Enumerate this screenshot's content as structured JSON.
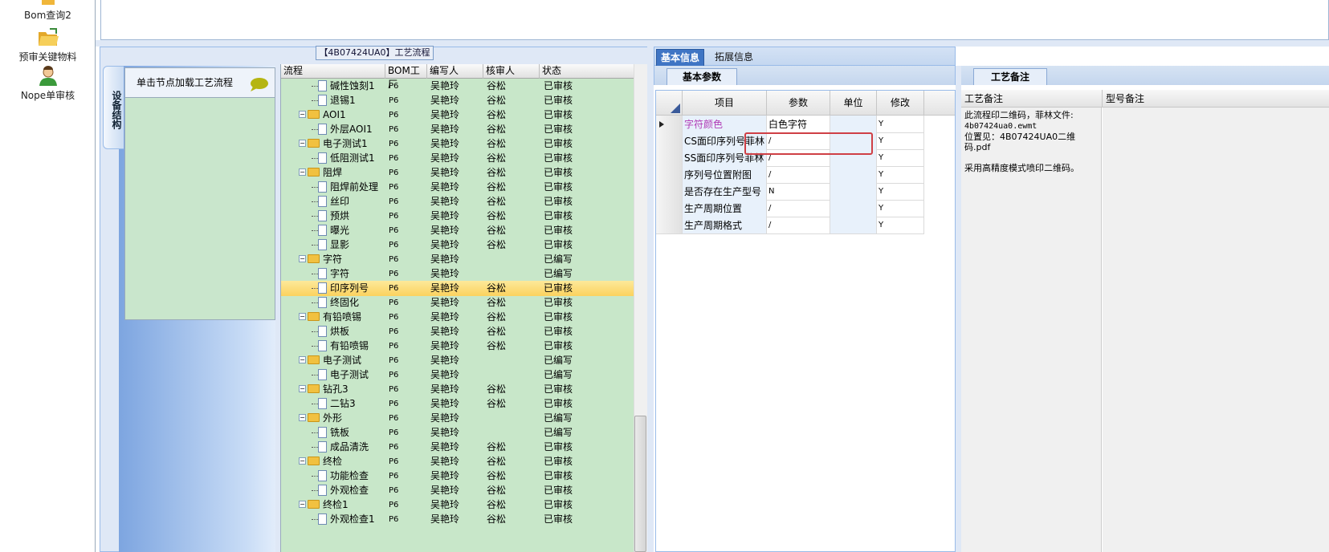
{
  "sidebar": {
    "items": [
      {
        "label": "Bom查询2",
        "icon": "bom-query-icon"
      },
      {
        "label": "预审关键物料",
        "icon": "folder-open-icon"
      },
      {
        "label": "Nope单审核",
        "icon": "user-icon"
      }
    ]
  },
  "process_panel": {
    "title": "【4B07424UA0】工艺流程",
    "vertical_tab": "设备结构",
    "node_header": "单击节点加载工艺流程"
  },
  "tree": {
    "columns": [
      "流程",
      "BOM工厂",
      "编写人",
      "核审人",
      "状态"
    ],
    "rows": [
      {
        "name": "碱性蚀刻1",
        "level": 2,
        "kind": "doc",
        "plant": "P6",
        "writer": "吴艳玲",
        "reviewer": "谷松",
        "status": "已审核"
      },
      {
        "name": "退锡1",
        "level": 2,
        "kind": "doc",
        "plant": "P6",
        "writer": "吴艳玲",
        "reviewer": "谷松",
        "status": "已审核"
      },
      {
        "name": "AOI1",
        "level": 1,
        "kind": "folder",
        "plant": "P6",
        "writer": "吴艳玲",
        "reviewer": "谷松",
        "status": "已审核"
      },
      {
        "name": "外层AOI1",
        "level": 2,
        "kind": "doc",
        "plant": "P6",
        "writer": "吴艳玲",
        "reviewer": "谷松",
        "status": "已审核"
      },
      {
        "name": "电子测试1",
        "level": 1,
        "kind": "folder",
        "plant": "P6",
        "writer": "吴艳玲",
        "reviewer": "谷松",
        "status": "已审核"
      },
      {
        "name": "低阻测试1",
        "level": 2,
        "kind": "doc",
        "plant": "P6",
        "writer": "吴艳玲",
        "reviewer": "谷松",
        "status": "已审核"
      },
      {
        "name": "阻焊",
        "level": 1,
        "kind": "folder",
        "plant": "P6",
        "writer": "吴艳玲",
        "reviewer": "谷松",
        "status": "已审核"
      },
      {
        "name": "阻焊前处理",
        "level": 2,
        "kind": "doc",
        "plant": "P6",
        "writer": "吴艳玲",
        "reviewer": "谷松",
        "status": "已审核"
      },
      {
        "name": "丝印",
        "level": 2,
        "kind": "doc",
        "plant": "P6",
        "writer": "吴艳玲",
        "reviewer": "谷松",
        "status": "已审核"
      },
      {
        "name": "预烘",
        "level": 2,
        "kind": "doc",
        "plant": "P6",
        "writer": "吴艳玲",
        "reviewer": "谷松",
        "status": "已审核"
      },
      {
        "name": "曝光",
        "level": 2,
        "kind": "doc",
        "plant": "P6",
        "writer": "吴艳玲",
        "reviewer": "谷松",
        "status": "已审核"
      },
      {
        "name": "显影",
        "level": 2,
        "kind": "doc",
        "plant": "P6",
        "writer": "吴艳玲",
        "reviewer": "谷松",
        "status": "已审核"
      },
      {
        "name": "字符",
        "level": 1,
        "kind": "folder",
        "plant": "P6",
        "writer": "吴艳玲",
        "reviewer": "",
        "status": "已编写"
      },
      {
        "name": "字符",
        "level": 2,
        "kind": "doc",
        "plant": "P6",
        "writer": "吴艳玲",
        "reviewer": "",
        "status": "已编写"
      },
      {
        "name": "印序列号",
        "level": 2,
        "kind": "doc",
        "plant": "P6",
        "writer": "吴艳玲",
        "reviewer": "谷松",
        "status": "已审核",
        "selected": true
      },
      {
        "name": "终固化",
        "level": 2,
        "kind": "doc",
        "plant": "P6",
        "writer": "吴艳玲",
        "reviewer": "谷松",
        "status": "已审核"
      },
      {
        "name": "有铅喷锡",
        "level": 1,
        "kind": "folder",
        "plant": "P6",
        "writer": "吴艳玲",
        "reviewer": "谷松",
        "status": "已审核"
      },
      {
        "name": "烘板",
        "level": 2,
        "kind": "doc",
        "plant": "P6",
        "writer": "吴艳玲",
        "reviewer": "谷松",
        "status": "已审核"
      },
      {
        "name": "有铅喷锡",
        "level": 2,
        "kind": "doc",
        "plant": "P6",
        "writer": "吴艳玲",
        "reviewer": "谷松",
        "status": "已审核"
      },
      {
        "name": "电子测试",
        "level": 1,
        "kind": "folder",
        "plant": "P6",
        "writer": "吴艳玲",
        "reviewer": "",
        "status": "已编写"
      },
      {
        "name": "电子测试",
        "level": 2,
        "kind": "doc",
        "plant": "P6",
        "writer": "吴艳玲",
        "reviewer": "",
        "status": "已编写"
      },
      {
        "name": "钻孔3",
        "level": 1,
        "kind": "folder",
        "plant": "P6",
        "writer": "吴艳玲",
        "reviewer": "谷松",
        "status": "已审核"
      },
      {
        "name": "二钻3",
        "level": 2,
        "kind": "doc",
        "plant": "P6",
        "writer": "吴艳玲",
        "reviewer": "谷松",
        "status": "已审核"
      },
      {
        "name": "外形",
        "level": 1,
        "kind": "folder",
        "plant": "P6",
        "writer": "吴艳玲",
        "reviewer": "",
        "status": "已编写"
      },
      {
        "name": "铣板",
        "level": 2,
        "kind": "doc",
        "plant": "P6",
        "writer": "吴艳玲",
        "reviewer": "",
        "status": "已编写"
      },
      {
        "name": "成品清洗",
        "level": 2,
        "kind": "doc",
        "plant": "P6",
        "writer": "吴艳玲",
        "reviewer": "谷松",
        "status": "已审核"
      },
      {
        "name": "终检",
        "level": 1,
        "kind": "folder",
        "plant": "P6",
        "writer": "吴艳玲",
        "reviewer": "谷松",
        "status": "已审核"
      },
      {
        "name": "功能检查",
        "level": 2,
        "kind": "doc",
        "plant": "P6",
        "writer": "吴艳玲",
        "reviewer": "谷松",
        "status": "已审核"
      },
      {
        "name": "外观检查",
        "level": 2,
        "kind": "doc",
        "plant": "P6",
        "writer": "吴艳玲",
        "reviewer": "谷松",
        "status": "已审核"
      },
      {
        "name": "终检1",
        "level": 1,
        "kind": "folder",
        "plant": "P6",
        "writer": "吴艳玲",
        "reviewer": "谷松",
        "status": "已审核"
      },
      {
        "name": "外观检查1",
        "level": 2,
        "kind": "doc",
        "plant": "P6",
        "writer": "吴艳玲",
        "reviewer": "谷松",
        "status": "已审核"
      }
    ]
  },
  "info_tabs": {
    "basic": "基本信息",
    "extended": "拓展信息"
  },
  "param_tab": "基本参数",
  "param_grid": {
    "columns": [
      "项目",
      "参数",
      "单位",
      "修改"
    ],
    "rows": [
      {
        "item": "字符颜色",
        "param": "白色字符",
        "unit": "",
        "modify": "Y",
        "highlight": true
      },
      {
        "item": "CS面印序列号菲林",
        "param": "/",
        "unit": "",
        "modify": "Y"
      },
      {
        "item": "SS面印序列号菲林",
        "param": "/",
        "unit": "",
        "modify": "Y"
      },
      {
        "item": "序列号位置附图",
        "param": "/",
        "unit": "",
        "modify": "Y"
      },
      {
        "item": "是否存在生产型号",
        "param": "N",
        "unit": "",
        "modify": "Y"
      },
      {
        "item": "生产周期位置",
        "param": "/",
        "unit": "",
        "modify": "Y"
      },
      {
        "item": "生产周期格式",
        "param": "/",
        "unit": "",
        "modify": "Y"
      }
    ]
  },
  "right_panel": {
    "tab": "工艺备注",
    "col_note": "工艺备注",
    "col_type": "型号备注",
    "note_line1": "此流程印二维码，菲林文件:",
    "note_line2": "4b07424ua0.ewmt",
    "note_line3": "位置见：4B07424UA0二维码.pdf",
    "note_line4": "采用高精度模式喷印二维码。"
  },
  "colors": {
    "highlight_text": "#b03ab6",
    "tree_bg": "#c8e7c9",
    "selected_row": "#fbd25e",
    "red_box": "#cf3f45"
  }
}
